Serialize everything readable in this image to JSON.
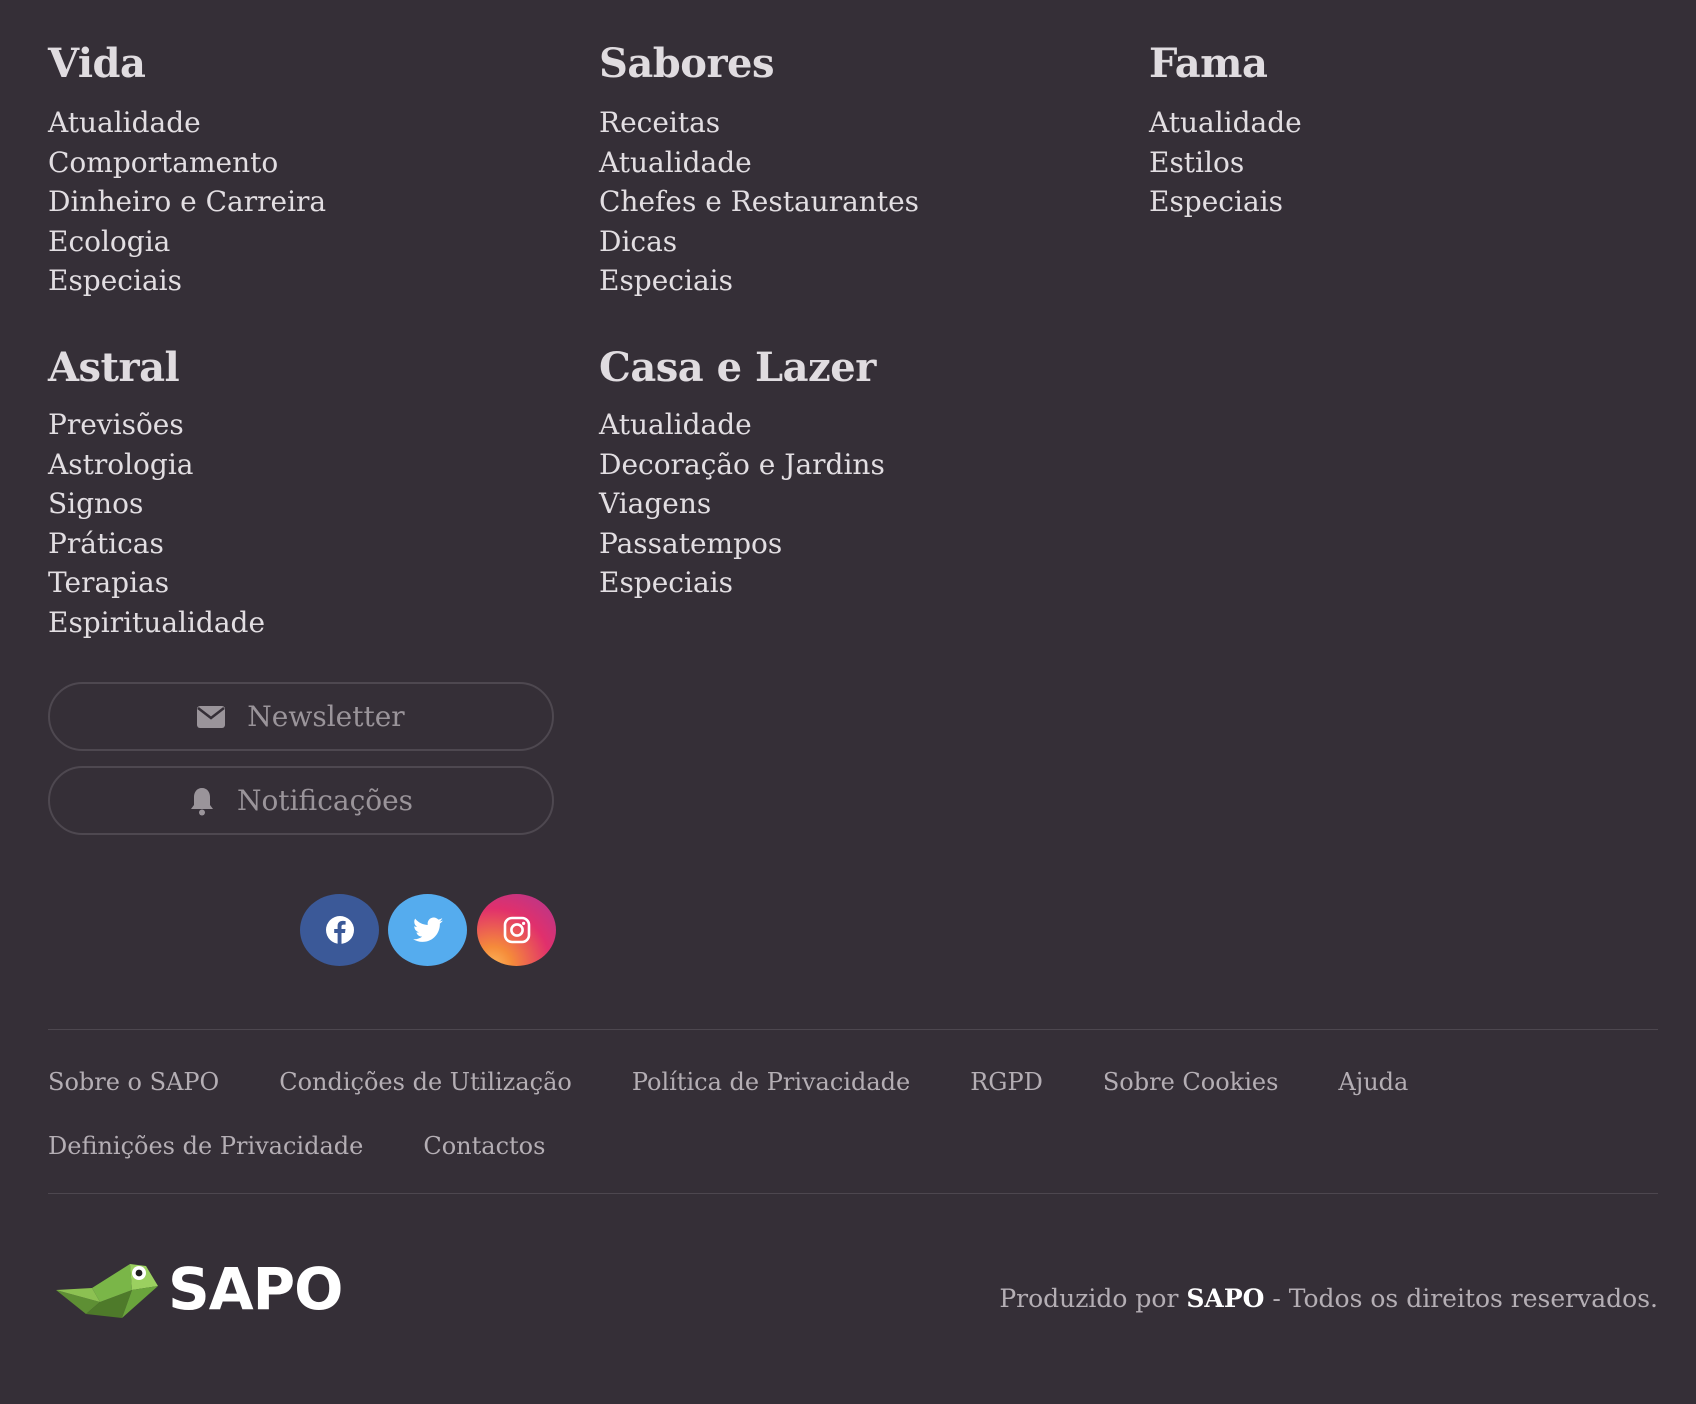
{
  "sections": {
    "vida": {
      "title": "Vida",
      "items": [
        "Atualidade",
        "Comportamento",
        "Dinheiro e Carreira",
        "Ecologia",
        "Especiais"
      ]
    },
    "sabores": {
      "title": "Sabores",
      "items": [
        "Receitas",
        "Atualidade",
        "Chefes e Restaurantes",
        "Dicas",
        "Especiais"
      ]
    },
    "fama": {
      "title": "Fama",
      "items": [
        "Atualidade",
        "Estilos",
        "Especiais"
      ]
    },
    "astral": {
      "title": "Astral",
      "items": [
        "Previsões",
        "Astrologia",
        "Signos",
        "Práticas",
        "Terapias",
        "Espiritualidade"
      ]
    },
    "casa": {
      "title": "Casa e Lazer",
      "items": [
        "Atualidade",
        "Decoração e Jardins",
        "Viagens",
        "Passatempos",
        "Especiais"
      ]
    }
  },
  "buttons": {
    "newsletter": {
      "label": "Newsletter",
      "icon": "envelope-icon"
    },
    "notifications": {
      "label": "Notificações",
      "icon": "bell-icon"
    }
  },
  "social": {
    "facebook": {
      "icon": "facebook-icon",
      "color": "#3b5998"
    },
    "twitter": {
      "icon": "twitter-icon",
      "color": "#55acee"
    },
    "instagram": {
      "icon": "instagram-icon",
      "color": "#e1306c"
    }
  },
  "legal": {
    "row1": [
      "Sobre o SAPO",
      "Condições de Utilização",
      "Política de Privacidade",
      "RGPD",
      "Sobre Cookies",
      "Ajuda"
    ],
    "row2": [
      "Definições de Privacidade",
      "Contactos"
    ]
  },
  "logo": {
    "text": "SAPO"
  },
  "copyright": {
    "prefix": "Produzido por",
    "brand": "SAPO",
    "suffix": "- Todos os direitos reservados."
  },
  "colors": {
    "background": "#352f37",
    "logo_green": "#7ab648"
  }
}
